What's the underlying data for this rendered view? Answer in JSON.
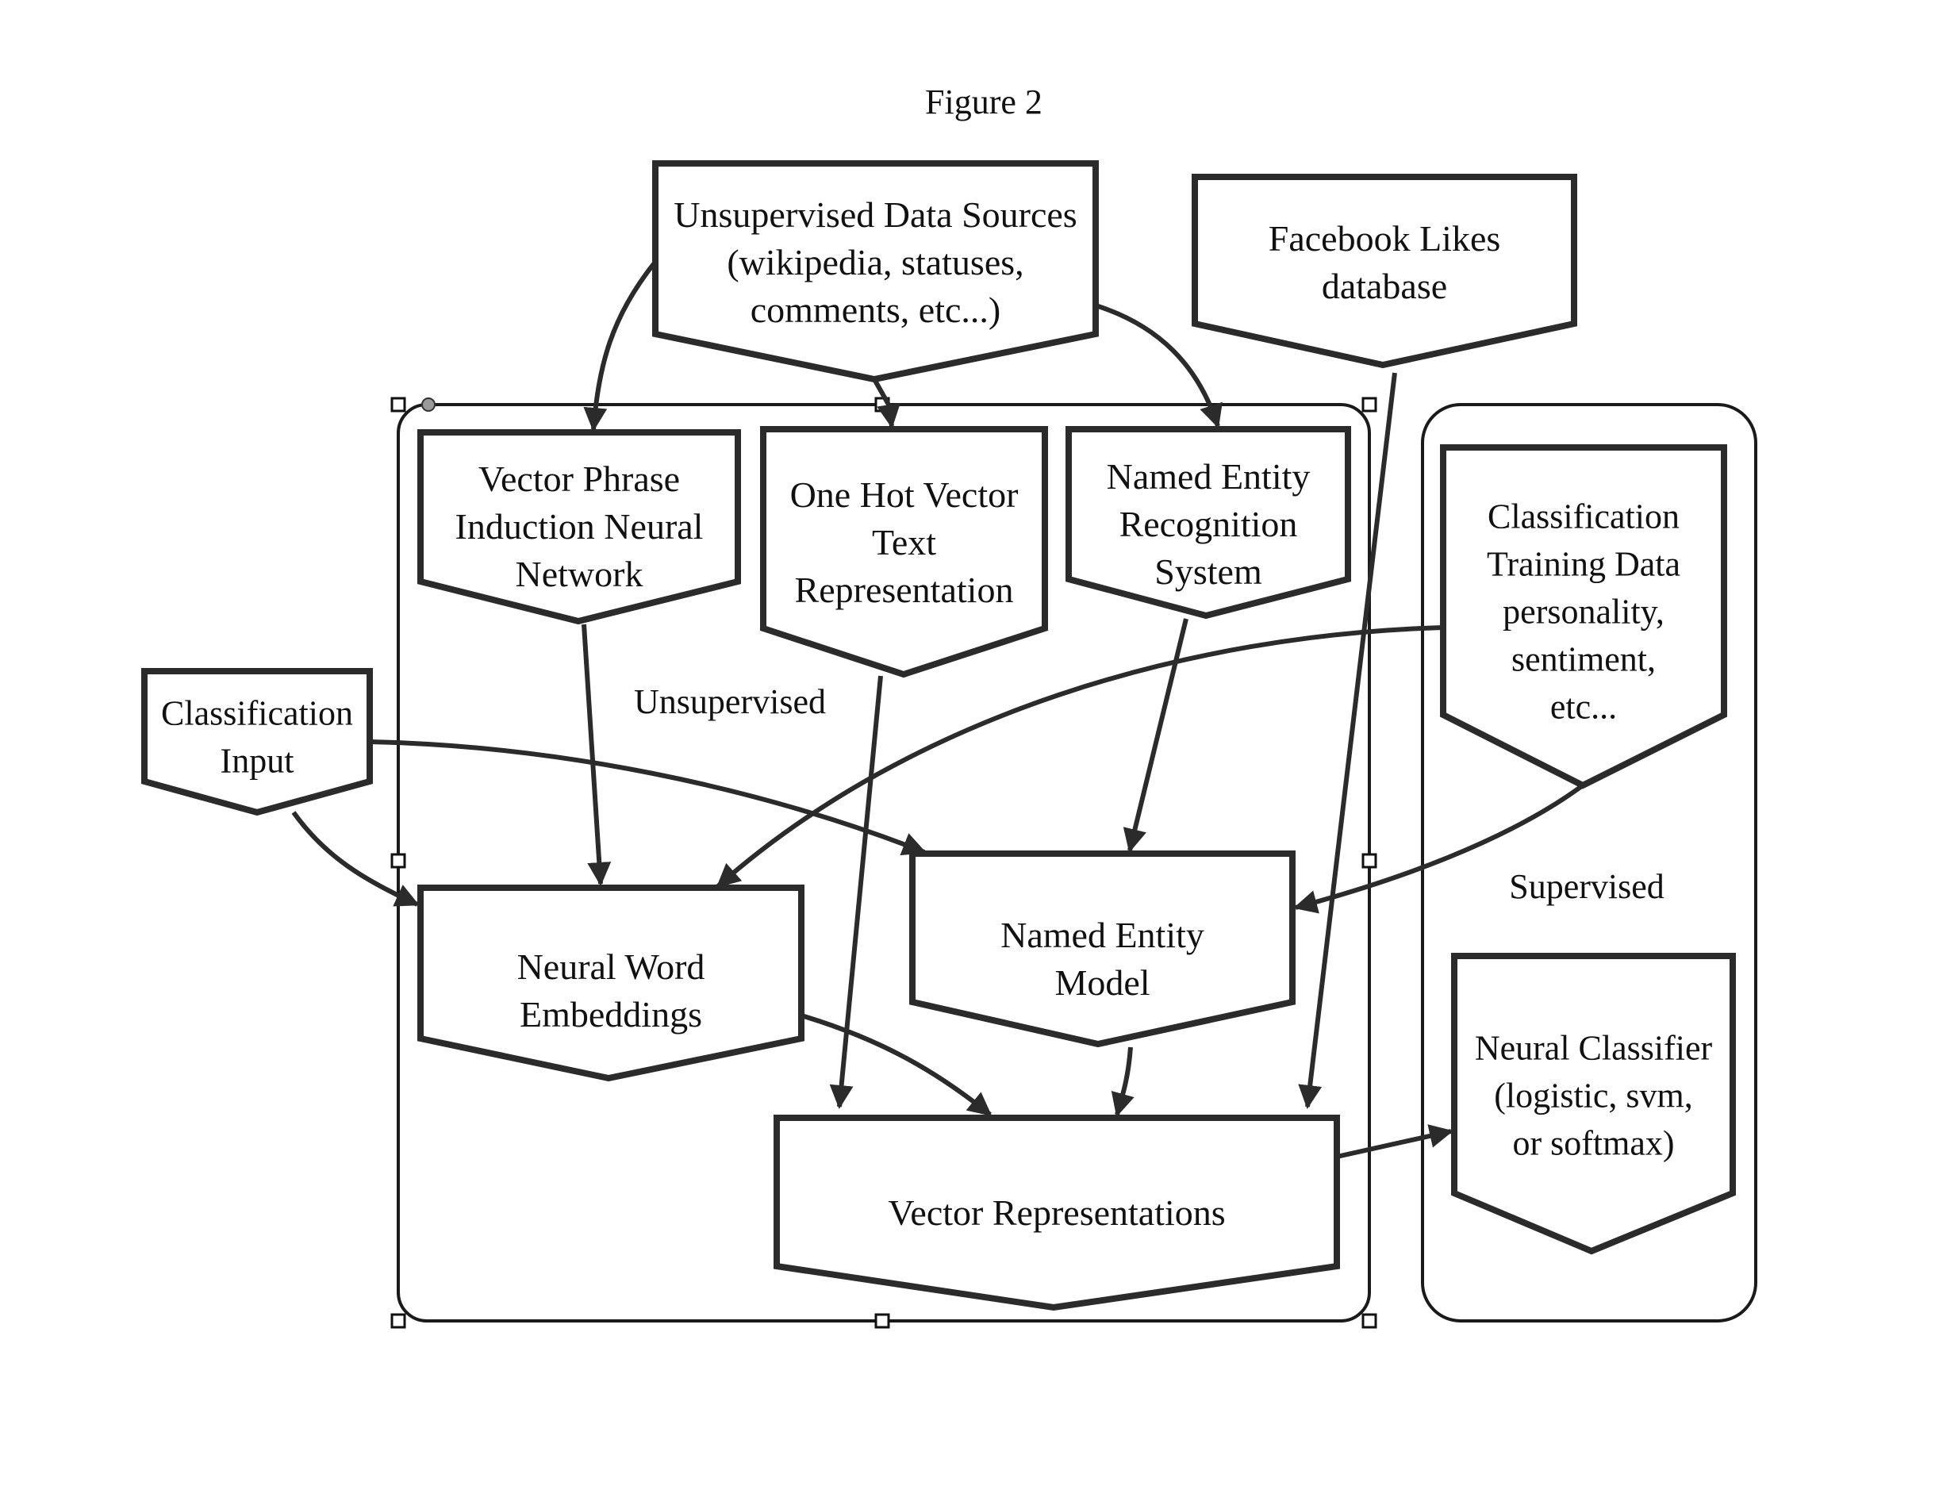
{
  "figure": {
    "title": "Figure 2"
  },
  "groups": [
    {
      "id": "unsupervised",
      "label": "Unsupervised"
    },
    {
      "id": "supervised",
      "label": "Supervised"
    }
  ],
  "nodes": [
    {
      "id": "unsup-sources",
      "lines": [
        "Unsupervised Data Sources",
        "(wikipedia, statuses,",
        "comments, etc...)"
      ]
    },
    {
      "id": "facebook-likes",
      "lines": [
        "Facebook Likes",
        "database"
      ]
    },
    {
      "id": "vector-phrase",
      "lines": [
        "Vector Phrase",
        "Induction Neural",
        "Network"
      ]
    },
    {
      "id": "one-hot",
      "lines": [
        "One Hot Vector",
        "Text",
        "Representation"
      ]
    },
    {
      "id": "ner-system",
      "lines": [
        "Named Entity",
        "Recognition",
        "System"
      ]
    },
    {
      "id": "class-training",
      "lines": [
        "Classification",
        "Training Data",
        "personality,",
        "sentiment,",
        "etc..."
      ]
    },
    {
      "id": "class-input",
      "lines": [
        "Classification",
        "Input"
      ]
    },
    {
      "id": "neural-word",
      "lines": [
        "Neural Word",
        "Embeddings"
      ]
    },
    {
      "id": "ne-model",
      "lines": [
        "Named Entity",
        "Model"
      ]
    },
    {
      "id": "vector-repr",
      "lines": [
        "Vector Representations"
      ]
    },
    {
      "id": "neural-classifier",
      "lines": [
        "Neural Classifier",
        "(logistic, svm,",
        "or softmax)"
      ]
    }
  ],
  "edges": [
    {
      "from": "unsup-sources",
      "to": "vector-phrase"
    },
    {
      "from": "unsup-sources",
      "to": "one-hot"
    },
    {
      "from": "unsup-sources",
      "to": "ner-system"
    },
    {
      "from": "facebook-likes",
      "to": "vector-repr"
    },
    {
      "from": "vector-phrase",
      "to": "neural-word"
    },
    {
      "from": "one-hot",
      "to": "vector-repr"
    },
    {
      "from": "ner-system",
      "to": "ne-model"
    },
    {
      "from": "class-training",
      "to": "neural-word"
    },
    {
      "from": "class-training",
      "to": "ne-model"
    },
    {
      "from": "class-input",
      "to": "neural-word"
    },
    {
      "from": "class-input",
      "to": "ne-model"
    },
    {
      "from": "neural-word",
      "to": "vector-repr"
    },
    {
      "from": "ne-model",
      "to": "vector-repr"
    },
    {
      "from": "vector-repr",
      "to": "neural-classifier"
    }
  ],
  "colors": {
    "ink": "#2b2b2b",
    "background": "#ffffff"
  }
}
